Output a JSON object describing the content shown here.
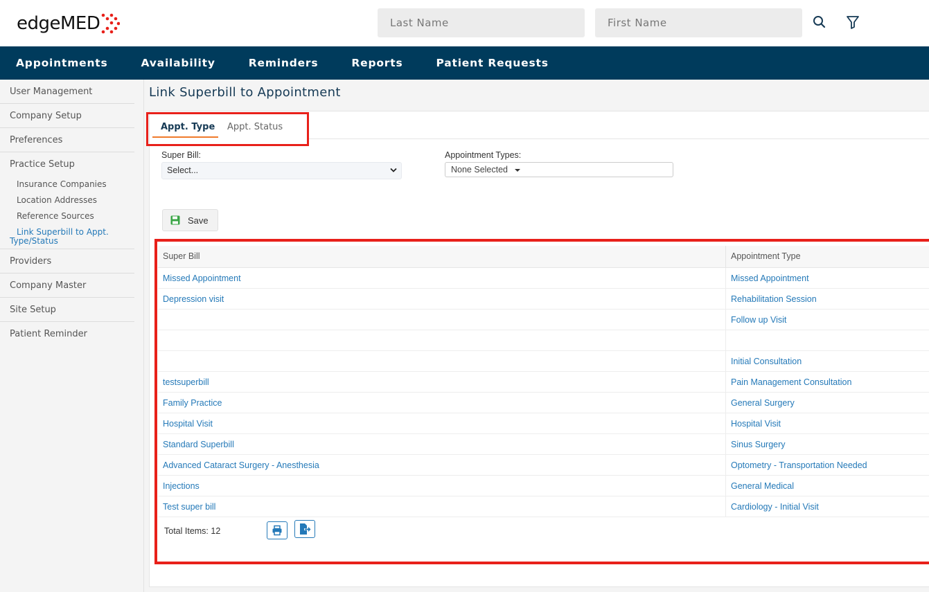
{
  "brand": {
    "name_part1": "edge",
    "name_part2": "MED",
    "dot_color": "#e8201a"
  },
  "search": {
    "last_name_placeholder": "Last Name",
    "first_name_placeholder": "First Name",
    "search_icon": "search-icon",
    "filter_icon": "filter-icon"
  },
  "nav": {
    "items": [
      "Appointments",
      "Availability",
      "Reminders",
      "Reports",
      "Patient Requests"
    ],
    "background": "#003b5c"
  },
  "sidebar": {
    "items": [
      "User Management",
      "Company Setup",
      "Preferences",
      "Practice Setup"
    ],
    "practice_setup_children": [
      "Insurance Companies",
      "Location Addresses",
      "Reference Sources"
    ],
    "active_child_line1": "Link Superbill to Appt.",
    "active_child_line2": "Type/Status",
    "items_after": [
      "Providers",
      "Company Master",
      "Site Setup",
      "Patient Reminder"
    ]
  },
  "page": {
    "title": "Link Superbill to Appointment"
  },
  "tabs": {
    "active": "Appt. Type",
    "inactive": "Appt. Status",
    "accent": "#f07a2a"
  },
  "form": {
    "super_bill_label": "Super Bill:",
    "super_bill_value": "Select...",
    "appointment_types_label": "Appointment Types:",
    "appointment_types_value": "None Selected",
    "save_label": "Save"
  },
  "grid": {
    "headers": [
      "Super Bill",
      "Appointment Type"
    ],
    "rows": [
      [
        "Missed Appointment",
        "Missed Appointment"
      ],
      [
        "Depression visit",
        "Rehabilitation Session"
      ],
      [
        "",
        "Follow up Visit"
      ],
      [
        "",
        ""
      ],
      [
        "",
        "Initial Consultation"
      ],
      [
        "testsuperbill",
        "Pain Management Consultation"
      ],
      [
        "Family Practice",
        "General Surgery"
      ],
      [
        "Hospital Visit",
        "Hospital Visit"
      ],
      [
        "Standard Superbill",
        "Sinus Surgery"
      ],
      [
        "Advanced Cataract Surgery - Anesthesia",
        "Optometry - Transportation Needed"
      ],
      [
        "Injections",
        "General Medical"
      ],
      [
        "Test super bill",
        "Cardiology - Initial Visit"
      ]
    ],
    "total_label": "Total Items: 12",
    "link_color": "#2479b8"
  },
  "highlight_color": "#e8201a"
}
